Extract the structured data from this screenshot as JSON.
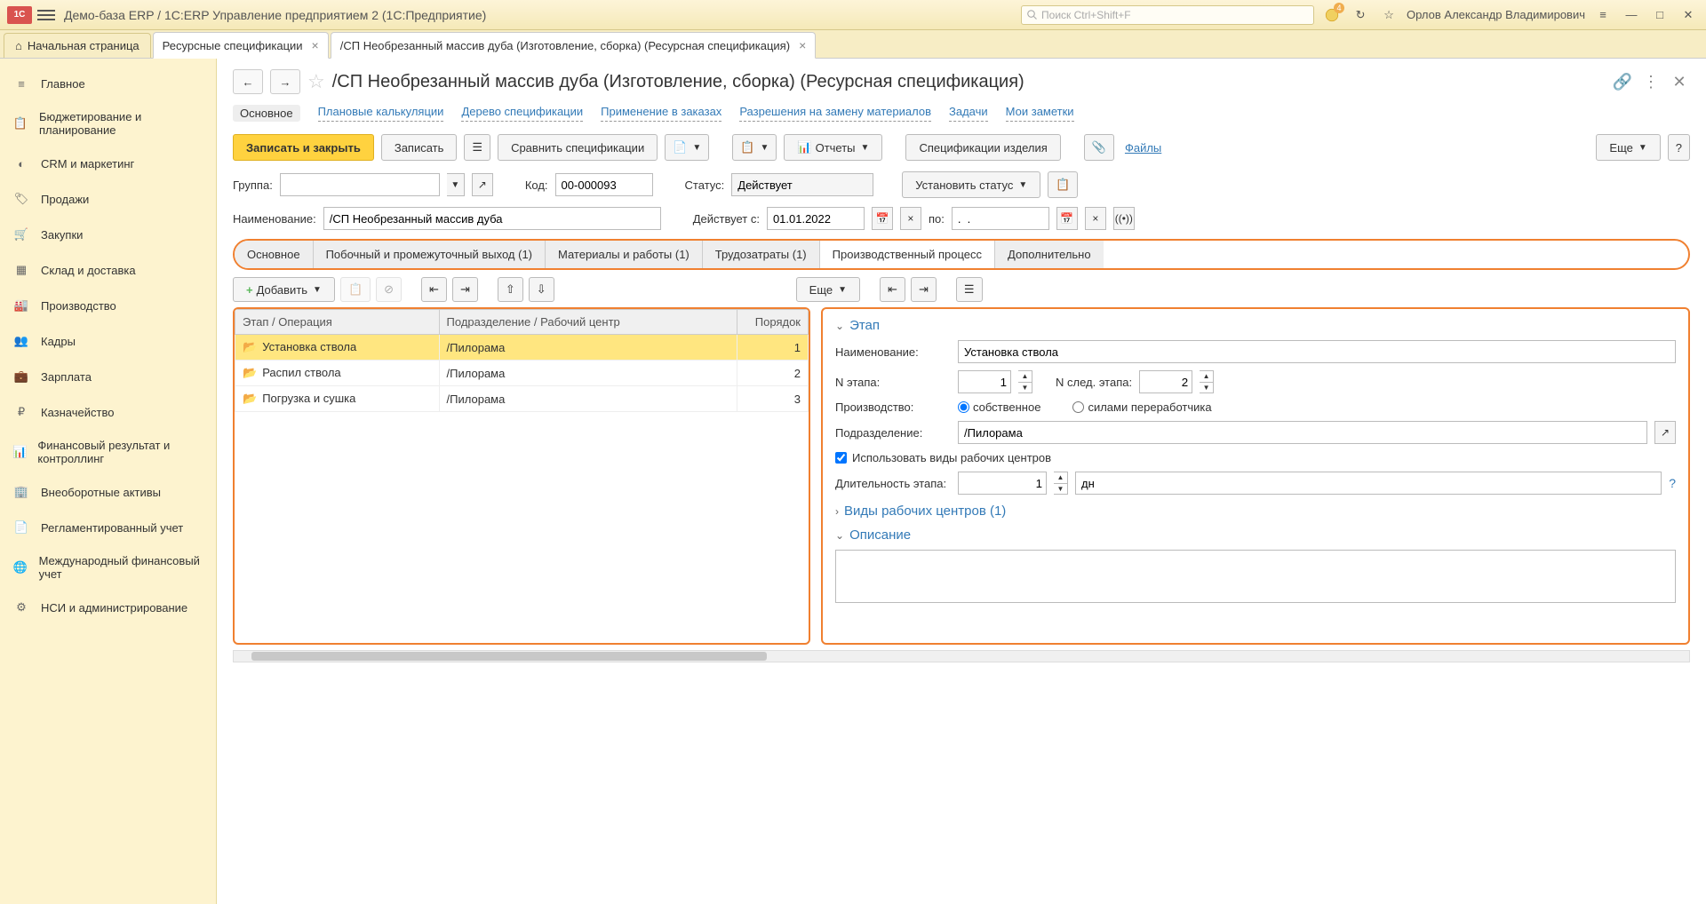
{
  "titlebar": {
    "title": "Демо-база ERP / 1С:ERP Управление предприятием 2  (1С:Предприятие)",
    "search_placeholder": "Поиск Ctrl+Shift+F",
    "user": "Орлов Александр Владимирович",
    "badge": "4"
  },
  "tabs": {
    "home": "Начальная страница",
    "t1": "Ресурсные спецификации",
    "t2": "/СП Необрезанный массив дуба (Изготовление, сборка) (Ресурсная спецификация)"
  },
  "sidebar": [
    "Главное",
    "Бюджетирование и планирование",
    "CRM и маркетинг",
    "Продажи",
    "Закупки",
    "Склад и доставка",
    "Производство",
    "Кадры",
    "Зарплата",
    "Казначейство",
    "Финансовый результат и контроллинг",
    "Внеоборотные активы",
    "Регламентированный учет",
    "Международный финансовый учет",
    "НСИ и администрирование"
  ],
  "page": {
    "title": "/СП Необрезанный массив дуба (Изготовление, сборка) (Ресурсная спецификация)"
  },
  "links": [
    "Основное",
    "Плановые калькуляции",
    "Дерево спецификации",
    "Применение в заказах",
    "Разрешения на замену материалов",
    "Задачи",
    "Мои заметки"
  ],
  "toolbar": {
    "save_close": "Записать и закрыть",
    "save": "Записать",
    "compare": "Сравнить спецификации",
    "reports": "Отчеты",
    "product_specs": "Спецификации изделия",
    "files": "Файлы",
    "more": "Еще"
  },
  "form": {
    "group_label": "Группа:",
    "code_label": "Код:",
    "code": "00-000093",
    "status_label": "Статус:",
    "status": "Действует",
    "set_status": "Установить статус",
    "name_label": "Наименование:",
    "name": "/СП Необрезанный массив дуба",
    "valid_from_label": "Действует с:",
    "valid_from": "01.01.2022",
    "to_label": "по:",
    "to_value": ".  ."
  },
  "intabs": [
    "Основное",
    "Побочный и промежуточный выход (1)",
    "Материалы и работы (1)",
    "Трудозатраты (1)",
    "Производственный процесс",
    "Дополнительно"
  ],
  "subtb": {
    "add": "Добавить",
    "more": "Еще"
  },
  "grid": {
    "h1": "Этап / Операция",
    "h2": "Подразделение / Рабочий центр",
    "h3": "Порядок",
    "rows": [
      {
        "op": "Установка ствола",
        "dept": "/Пилорама",
        "ord": "1"
      },
      {
        "op": "Распил ствола",
        "dept": "/Пилорама",
        "ord": "2"
      },
      {
        "op": "Погрузка и сушка",
        "dept": "/Пилорама",
        "ord": "3"
      }
    ]
  },
  "detail": {
    "stage_hdr": "Этап",
    "name_label": "Наименование:",
    "name": "Установка ствола",
    "stage_n_label": "N этапа:",
    "stage_n": "1",
    "next_n_label": "N след. этапа:",
    "next_n": "2",
    "prod_label": "Производство:",
    "prod_own": "собственное",
    "prod_ext": "силами переработчика",
    "dept_label": "Подразделение:",
    "dept": "/Пилорама",
    "use_wc": "Использовать виды рабочих центров",
    "duration_label": "Длительность этапа:",
    "duration": "1",
    "duration_unit": "дн",
    "wc_hdr": "Виды рабочих центров (1)",
    "desc_hdr": "Описание"
  }
}
